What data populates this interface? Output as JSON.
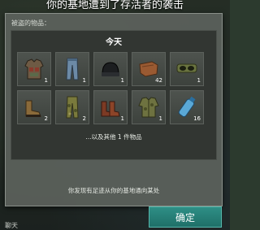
{
  "dialog": {
    "title": "你的基地遭到了存活者的袭击",
    "stolen_label": "被盗的物品：",
    "loot_heading": "今天",
    "more_items": "...以及其他 1 件物品",
    "footer_message": "你发现有足迹从你的基地通向某处",
    "confirm_label": "确定"
  },
  "items": [
    {
      "icon": "armor-vest-icon",
      "qty": "1"
    },
    {
      "icon": "pants-icon",
      "qty": "1"
    },
    {
      "icon": "beanie-hat-icon",
      "qty": "1"
    },
    {
      "icon": "leather-icon",
      "qty": "42"
    },
    {
      "icon": "goggles-icon",
      "qty": "1"
    },
    {
      "icon": "boots-icon",
      "qty": "2"
    },
    {
      "icon": "camo-pants-icon",
      "qty": "2"
    },
    {
      "icon": "leather-boots-icon",
      "qty": "1"
    },
    {
      "icon": "camo-jacket-icon",
      "qty": "1"
    },
    {
      "icon": "water-bottle-icon",
      "qty": "16"
    }
  ],
  "bottom_bar": {
    "chat_label": "聊天"
  },
  "colors": {
    "accent": "#2e8f86",
    "panel": "#5c625c",
    "cell": "#4e534e"
  }
}
